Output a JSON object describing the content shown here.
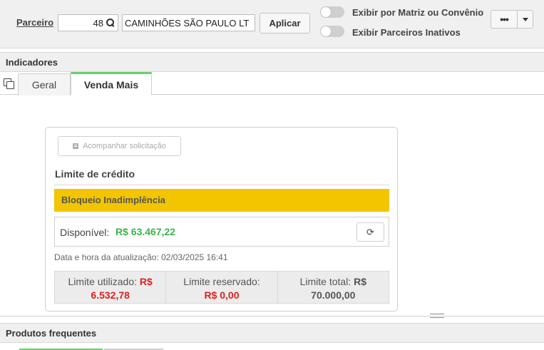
{
  "filter": {
    "partner_label": "Parceiro",
    "partner_code": "48",
    "partner_name": "CAMINHÕES SÃO PAULO LT",
    "apply_label": "Aplicar",
    "toggle_matrix_label": "Exibir por Matriz ou Convênio",
    "toggle_inactive_label": "Exibir Parceiros Inativos",
    "more_label": "•••"
  },
  "sections": {
    "indicators": "Indicadores",
    "frequent_products": "Produtos frequentes"
  },
  "tabs": [
    {
      "label": "Geral",
      "active": false
    },
    {
      "label": "Venda Mais",
      "active": true
    }
  ],
  "card": {
    "track_button": "Acompanhar solicitação",
    "credit_title": "Limite de crédito",
    "block_status": "Bloqueio Inadimplência",
    "available_label": "Disponível:",
    "available_value": "R$ 63.467,22",
    "update_text": "Data e hora da atualização: 02/03/2025 16:41",
    "limits": [
      {
        "label": "Limite utilizado:",
        "currency": "R$",
        "value": "6.532,78"
      },
      {
        "label": "Limite reservado:",
        "currency": "",
        "value": "R$ 0,00"
      },
      {
        "label": "Limite total:",
        "currency": "R$",
        "value": "70.000,00"
      }
    ]
  },
  "colors": {
    "accent_tab": "#6ccf6c",
    "block_bar": "#f2c500",
    "available_green": "#3cb44b",
    "limit_red": "#e02020"
  }
}
